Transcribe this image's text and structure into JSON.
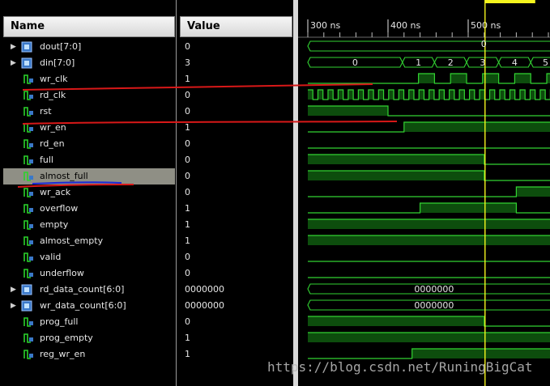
{
  "headers": {
    "name": "Name",
    "value": "Value"
  },
  "signals": [
    {
      "name": "dout[7:0]",
      "value": "0",
      "bus": true,
      "expandable": true
    },
    {
      "name": "din[7:0]",
      "value": "3",
      "bus": true,
      "expandable": true
    },
    {
      "name": "wr_clk",
      "value": "1"
    },
    {
      "name": "rd_clk",
      "value": "0"
    },
    {
      "name": "rst",
      "value": "0"
    },
    {
      "name": "wr_en",
      "value": "1"
    },
    {
      "name": "rd_en",
      "value": "0"
    },
    {
      "name": "full",
      "value": "0"
    },
    {
      "name": "almost_full",
      "value": "0",
      "selected": true
    },
    {
      "name": "wr_ack",
      "value": "0"
    },
    {
      "name": "overflow",
      "value": "1"
    },
    {
      "name": "empty",
      "value": "1"
    },
    {
      "name": "almost_empty",
      "value": "1"
    },
    {
      "name": "valid",
      "value": "0"
    },
    {
      "name": "underflow",
      "value": "0"
    },
    {
      "name": "rd_data_count[6:0]",
      "value": "0000000",
      "bus": true,
      "expandable": true
    },
    {
      "name": "wr_data_count[6:0]",
      "value": "0000000",
      "bus": true,
      "expandable": true
    },
    {
      "name": "prog_full",
      "value": "0"
    },
    {
      "name": "prog_empty",
      "value": "1"
    },
    {
      "name": "reg_wr_en",
      "value": "1"
    }
  ],
  "timeline": {
    "ticks": [
      {
        "label": "300 ns",
        "t": 300
      },
      {
        "label": "400 ns",
        "t": 400
      },
      {
        "label": "500 ns",
        "t": 500
      }
    ],
    "cursor_value": "0",
    "bus_labels": {
      "dout": "0",
      "din": [
        "0",
        "1",
        "2",
        "3",
        "4",
        "5"
      ],
      "rd_data_count": "0000000",
      "wr_data_count": "0000000"
    }
  },
  "watermark": "https://blog.csdn.net/RuningBigCat",
  "colors": {
    "wave": "#32d232",
    "fill": "#0d4d0d",
    "cursor": "#f5f51e",
    "annot_red": "#d81818",
    "annot_blue": "#1a28d6"
  }
}
